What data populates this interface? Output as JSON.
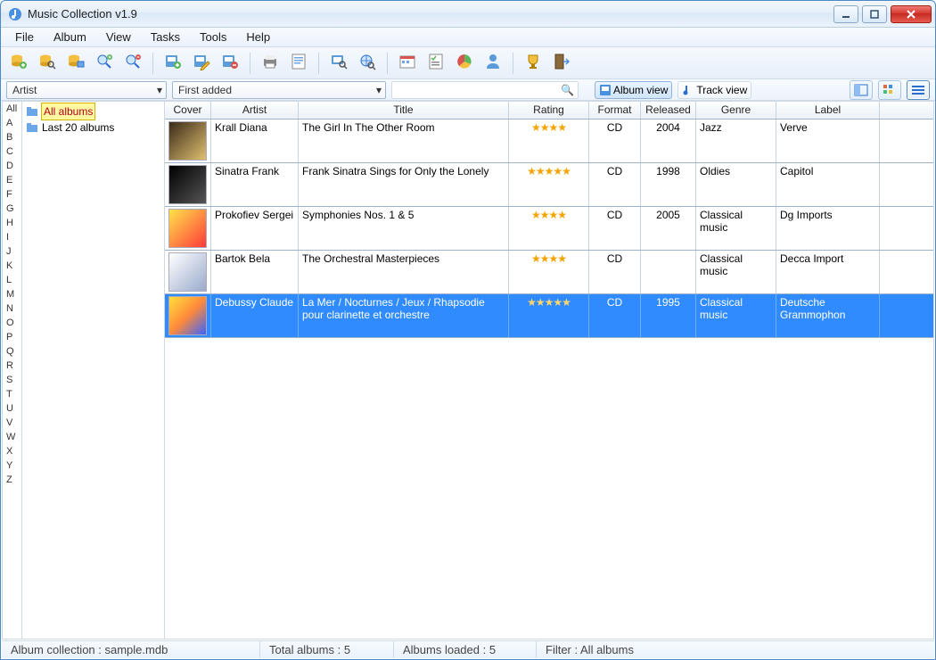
{
  "window": {
    "title": "Music Collection v1.9"
  },
  "menu": {
    "items": [
      "File",
      "Album",
      "View",
      "Tasks",
      "Tools",
      "Help"
    ]
  },
  "toolbar": {
    "buttons": [
      {
        "name": "db-add-icon",
        "tip": "Open database"
      },
      {
        "name": "db-search-icon",
        "tip": "Search database"
      },
      {
        "name": "db-preview-icon",
        "tip": "Preview"
      },
      {
        "name": "zoom-in-icon",
        "tip": "Zoom in"
      },
      {
        "name": "zoom-out-icon",
        "tip": "Zoom out"
      },
      {
        "sep": true
      },
      {
        "name": "album-add-icon",
        "tip": "Add album"
      },
      {
        "name": "album-edit-icon",
        "tip": "Edit album"
      },
      {
        "name": "album-delete-icon",
        "tip": "Delete album"
      },
      {
        "sep": true
      },
      {
        "name": "print-icon",
        "tip": "Print"
      },
      {
        "name": "report-icon",
        "tip": "Reports"
      },
      {
        "sep": true
      },
      {
        "name": "find-icon",
        "tip": "Find"
      },
      {
        "name": "find-web-icon",
        "tip": "Web search"
      },
      {
        "sep": true
      },
      {
        "name": "calendar-icon",
        "tip": "Calendar"
      },
      {
        "name": "checklist-icon",
        "tip": "Checklist"
      },
      {
        "name": "stats-icon",
        "tip": "Statistics"
      },
      {
        "name": "user-icon",
        "tip": "User"
      },
      {
        "sep": true
      },
      {
        "name": "trophy-icon",
        "tip": "Awards"
      },
      {
        "name": "exit-icon",
        "tip": "Exit"
      }
    ]
  },
  "filterbar": {
    "combo1": {
      "label": "Artist"
    },
    "combo2": {
      "label": "First added"
    },
    "search": {
      "placeholder": ""
    },
    "view_album": "Album view",
    "view_track": "Track view"
  },
  "alpha": [
    "All",
    "A",
    "B",
    "C",
    "D",
    "E",
    "F",
    "G",
    "H",
    "I",
    "J",
    "K",
    "L",
    "M",
    "N",
    "O",
    "P",
    "Q",
    "R",
    "S",
    "T",
    "U",
    "V",
    "W",
    "X",
    "Y",
    "Z"
  ],
  "tree": {
    "nodes": [
      {
        "label": "All albums",
        "selected": true
      },
      {
        "label": "Last 20 albums",
        "selected": false
      }
    ]
  },
  "grid": {
    "columns": [
      "Cover",
      "Artist",
      "Title",
      "Rating",
      "Format",
      "Released",
      "Genre",
      "Label"
    ],
    "rows": [
      {
        "artist": "Krall Diana",
        "title": "The Girl In The Other Room",
        "rating": 4,
        "format": "CD",
        "released": "2004",
        "genre": "Jazz",
        "label": "Verve",
        "cover": "cover-grad-1",
        "selected": false
      },
      {
        "artist": "Sinatra Frank",
        "title": "Frank Sinatra Sings for Only the Lonely",
        "rating": 5,
        "format": "CD",
        "released": "1998",
        "genre": "Oldies",
        "label": "Capitol",
        "cover": "cover-grad-2",
        "selected": false
      },
      {
        "artist": "Prokofiev Sergei",
        "title": "Symphonies Nos. 1 & 5",
        "rating": 4,
        "format": "CD",
        "released": "2005",
        "genre": "Classical music",
        "label": "Dg Imports",
        "cover": "cover-grad-3",
        "selected": false
      },
      {
        "artist": "Bartok Bela",
        "title": "The Orchestral Masterpieces",
        "rating": 4,
        "format": "CD",
        "released": "",
        "genre": "Classical music",
        "label": "Decca Import",
        "cover": "cover-grad-4",
        "selected": false
      },
      {
        "artist": "Debussy Claude",
        "title": "La Mer / Nocturnes / Jeux / Rhapsodie pour clarinette et orchestre",
        "rating": 5,
        "format": "CD",
        "released": "1995",
        "genre": "Classical music",
        "label": "Deutsche Grammophon",
        "cover": "cover-grad-5",
        "selected": true
      }
    ]
  },
  "status": {
    "collection": "Album collection : sample.mdb",
    "total": "Total albums : 5",
    "loaded": "Albums loaded : 5",
    "filter": "Filter : All albums"
  }
}
